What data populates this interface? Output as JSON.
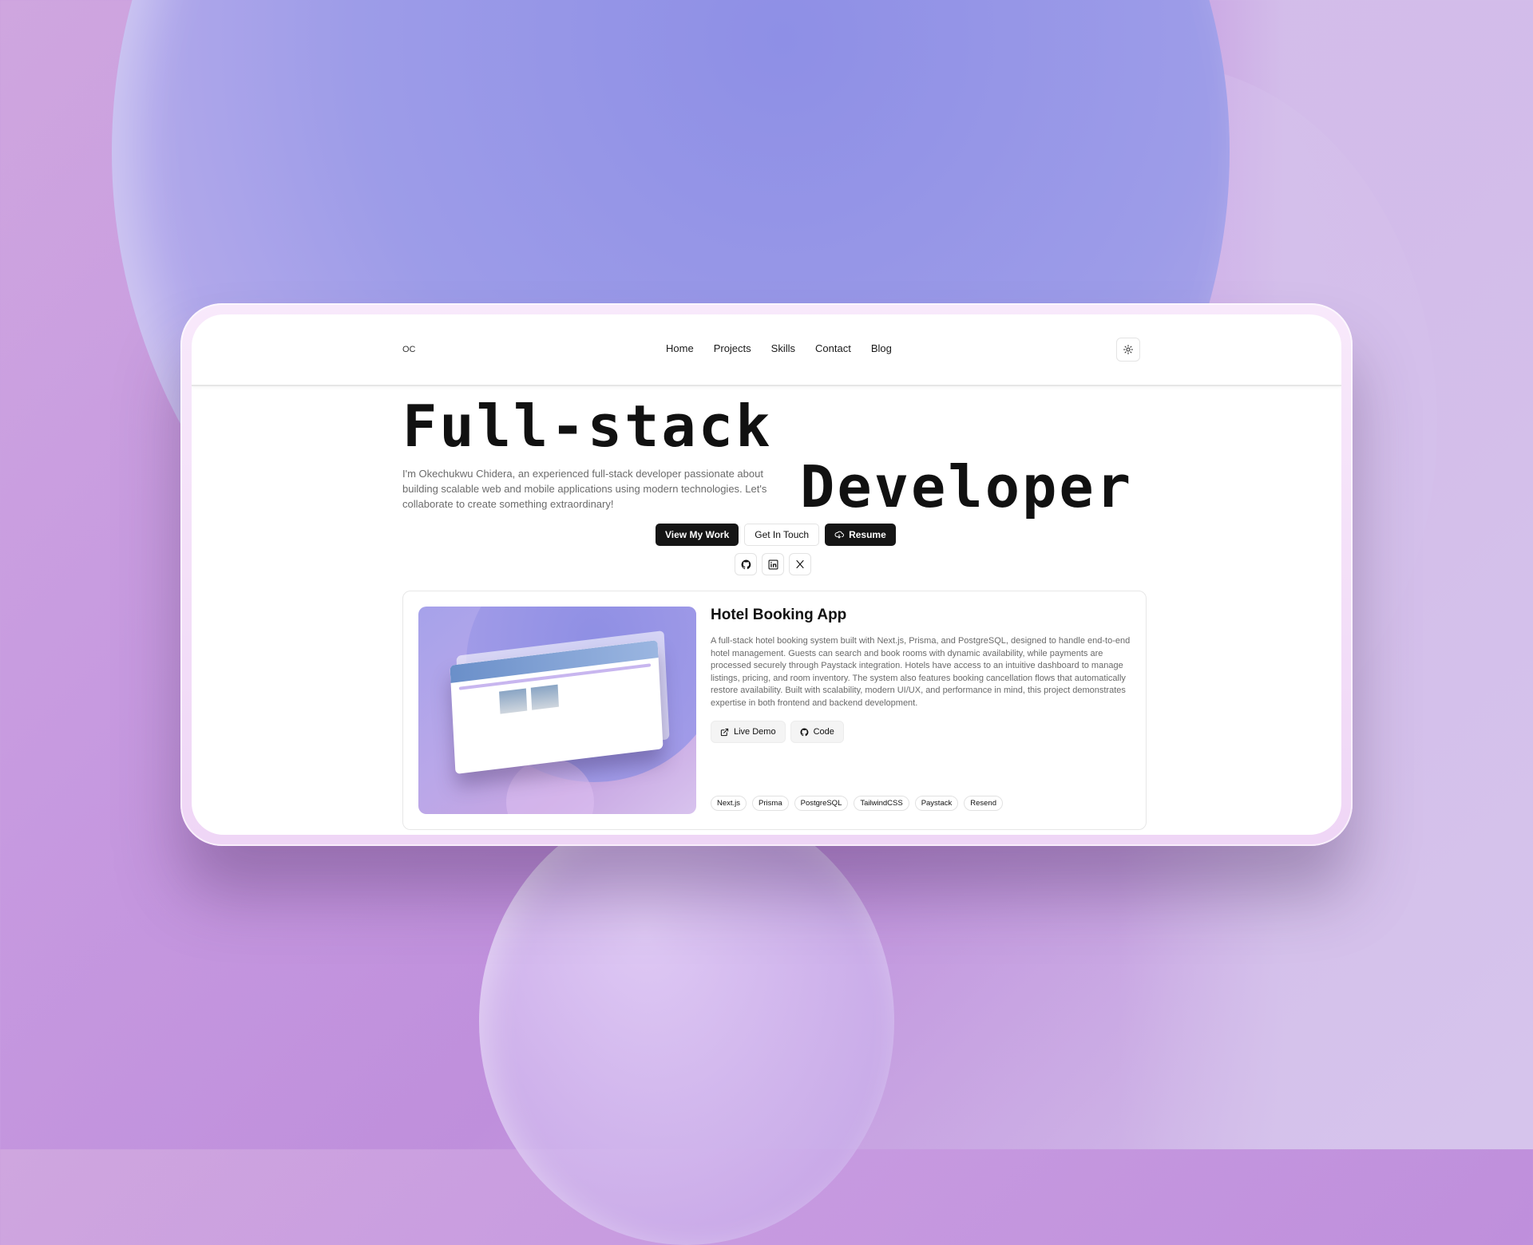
{
  "nav": {
    "logo": "OC",
    "links": [
      "Home",
      "Projects",
      "Skills",
      "Contact",
      "Blog"
    ],
    "theme_icon": "sun-icon"
  },
  "hero": {
    "title_line1": "Full-stack",
    "title_line2": "Developer",
    "description": "I'm Okechukwu Chidera, an experienced full-stack developer passionate about building scalable web and mobile applications using modern technologies. Let's collaborate to create something extraordinary!",
    "buttons": {
      "view_work": "View My Work",
      "get_in_touch": "Get In Touch",
      "resume": "Resume"
    },
    "socials": [
      "github-icon",
      "linkedin-icon",
      "x-icon"
    ]
  },
  "project": {
    "title": "Hotel Booking App",
    "description": "A full-stack hotel booking system built with Next.js, Prisma, and PostgreSQL, designed to handle end-to-end hotel management. Guests can search and book rooms with dynamic availability, while payments are processed securely through Paystack integration. Hotels have access to an intuitive dashboard to manage listings, pricing, and room inventory. The system also features booking cancellation flows that automatically restore availability. Built with scalability, modern UI/UX, and performance in mind, this project demonstrates expertise in both frontend and backend development.",
    "live_demo": "Live Demo",
    "code": "Code",
    "tags": [
      "Next.js",
      "Prisma",
      "PostgreSQL",
      "TailwindCSS",
      "Paystack",
      "Resend"
    ]
  },
  "colors": {
    "dark_button": "#151515",
    "background_purple": "#bf8fdc",
    "blob_blue": "#8e8fe6"
  }
}
